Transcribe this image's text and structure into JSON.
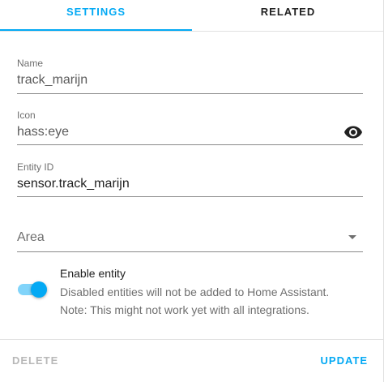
{
  "tabs": {
    "settings": "Settings",
    "related": "Related"
  },
  "fields": {
    "name": {
      "label": "Name",
      "value": "track_marijn"
    },
    "icon": {
      "label": "Icon",
      "value": "hass:eye",
      "preview_icon": "eye-icon"
    },
    "entity": {
      "label": "Entity ID",
      "value": "sensor.track_marijn"
    },
    "area": {
      "placeholder": "Area"
    }
  },
  "enable": {
    "title": "Enable entity",
    "desc_line1": "Disabled entities will not be added to Home Assistant.",
    "desc_line2": "Note: This might not work yet with all integrations.",
    "enabled": true
  },
  "footer": {
    "delete_label": "Delete",
    "update_label": "Update"
  },
  "colors": {
    "accent": "#03a9f4",
    "accent_light": "#81d4fa",
    "disabled_text": "#b8b8b8"
  }
}
